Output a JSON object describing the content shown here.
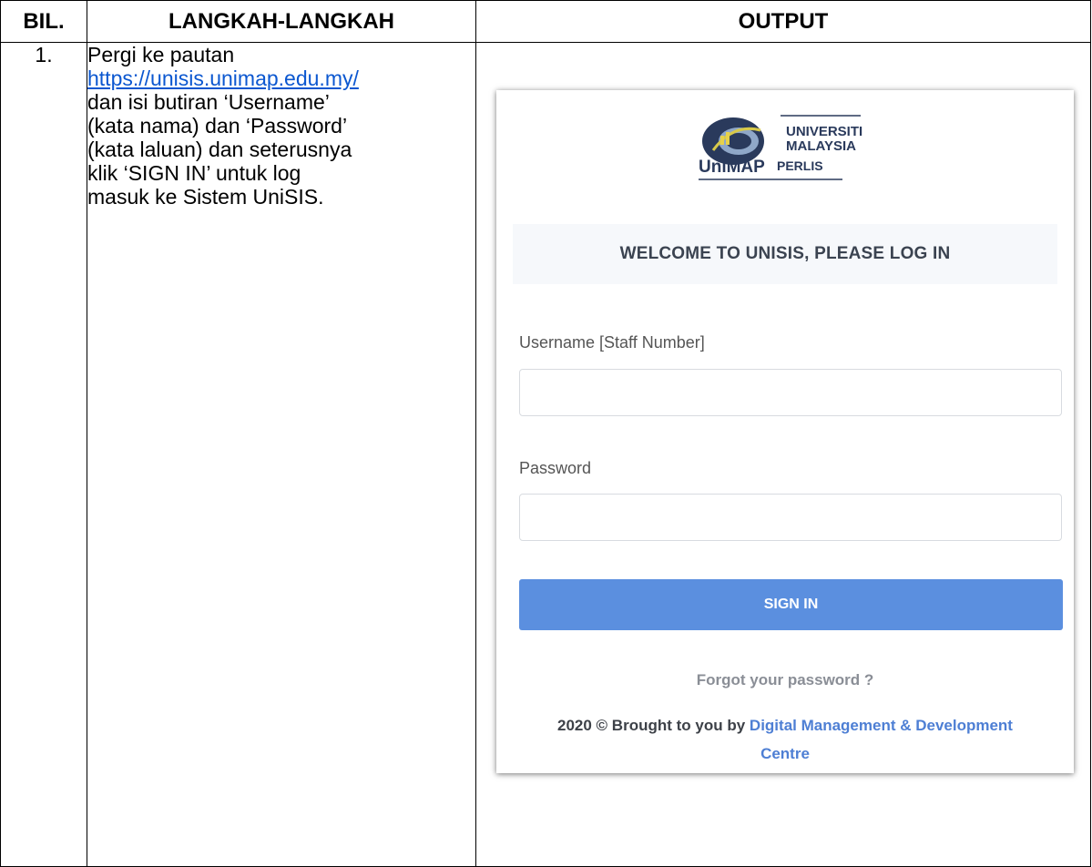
{
  "table": {
    "headers": [
      "BIL.",
      "LANGKAH-LANGKAH",
      "OUTPUT"
    ],
    "row": {
      "number": "1.",
      "step_lines": {
        "l1": "Pergi ke pautan",
        "link": "https://unisis.unimap.edu.my/",
        "l3": "dan isi butiran ‘Username’",
        "l4": "(kata nama) dan ‘Password’",
        "l5": "(kata laluan) dan seterusnya",
        "l6": "klik ‘SIGN IN’ untuk log",
        "l7": "masuk ke Sistem UniSIS."
      }
    }
  },
  "login": {
    "logo": {
      "line1": "UNIVERSITI",
      "line2": "MALAYSIA",
      "line3": "PERLIS",
      "brand": "UniMAP"
    },
    "welcome": "WELCOME TO UNISIS, PLEASE LOG IN",
    "username_label": "Username [Staff Number]",
    "password_label": "Password",
    "username_value": "",
    "password_value": "",
    "signin_label": "SIGN IN",
    "forgot_label": "Forgot your password ?",
    "footer_prefix": "2020 © Brought to you by",
    "footer_org": "Digital Management & Development Centre",
    "colors": {
      "button": "#5b8fdf",
      "link": "#4e7fd4",
      "url": "#0b57d0"
    }
  }
}
